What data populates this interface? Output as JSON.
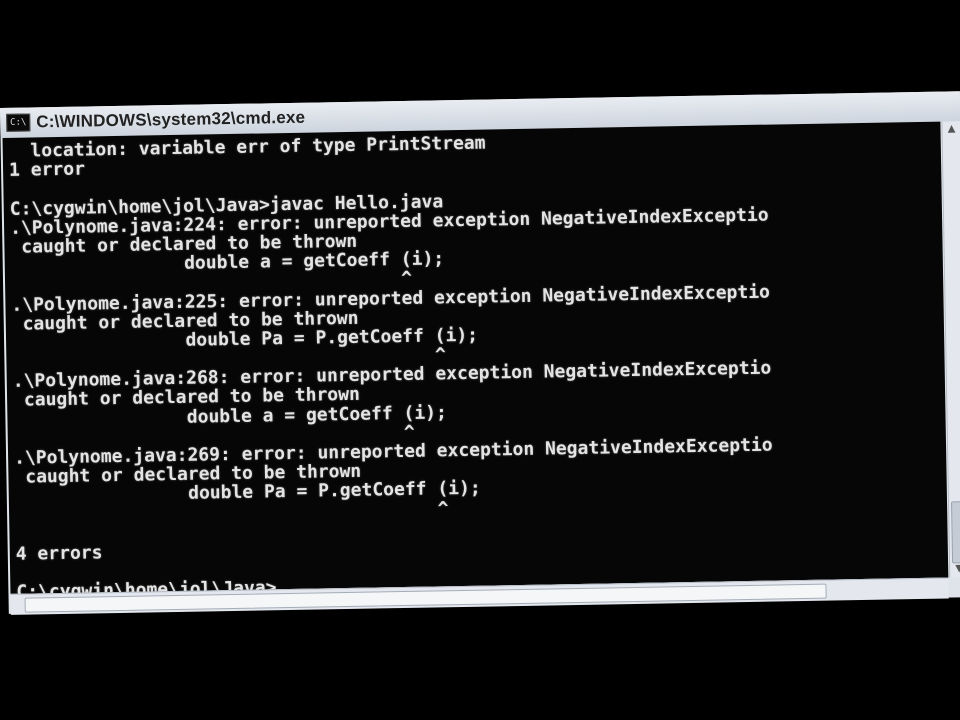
{
  "window": {
    "title": "C:\\WINDOWS\\system32\\cmd.exe",
    "icon_text": "C:\\"
  },
  "console": {
    "lines": [
      "  location: variable err of type PrintStream",
      "1 error",
      "",
      "C:\\cygwin\\home\\jol\\Java>javac Hello.java",
      ".\\Polynome.java:224: error: unreported exception NegativeIndexExceptio",
      " caught or declared to be thrown",
      "                double a = getCoeff (i);",
      "                                    ^",
      ".\\Polynome.java:225: error: unreported exception NegativeIndexExceptio",
      " caught or declared to be thrown",
      "                double Pa = P.getCoeff (i);",
      "                                       ^",
      ".\\Polynome.java:268: error: unreported exception NegativeIndexExceptio",
      " caught or declared to be thrown",
      "                double a = getCoeff (i);",
      "                                    ^",
      ".\\Polynome.java:269: error: unreported exception NegativeIndexExceptio",
      " caught or declared to be thrown",
      "                double Pa = P.getCoeff (i);",
      "                                       ^",
      "",
      "4 errors",
      ""
    ],
    "prompt": "C:\\cygwin\\home\\jol\\Java>"
  },
  "colors": {
    "console_bg": "#060606",
    "console_fg": "#e4e4e4",
    "titlebar": "#dfe4ea"
  },
  "icons": {
    "window_icon": "cmd-icon",
    "scroll_up": "arrow-up-icon",
    "scroll_down": "arrow-down-icon"
  }
}
